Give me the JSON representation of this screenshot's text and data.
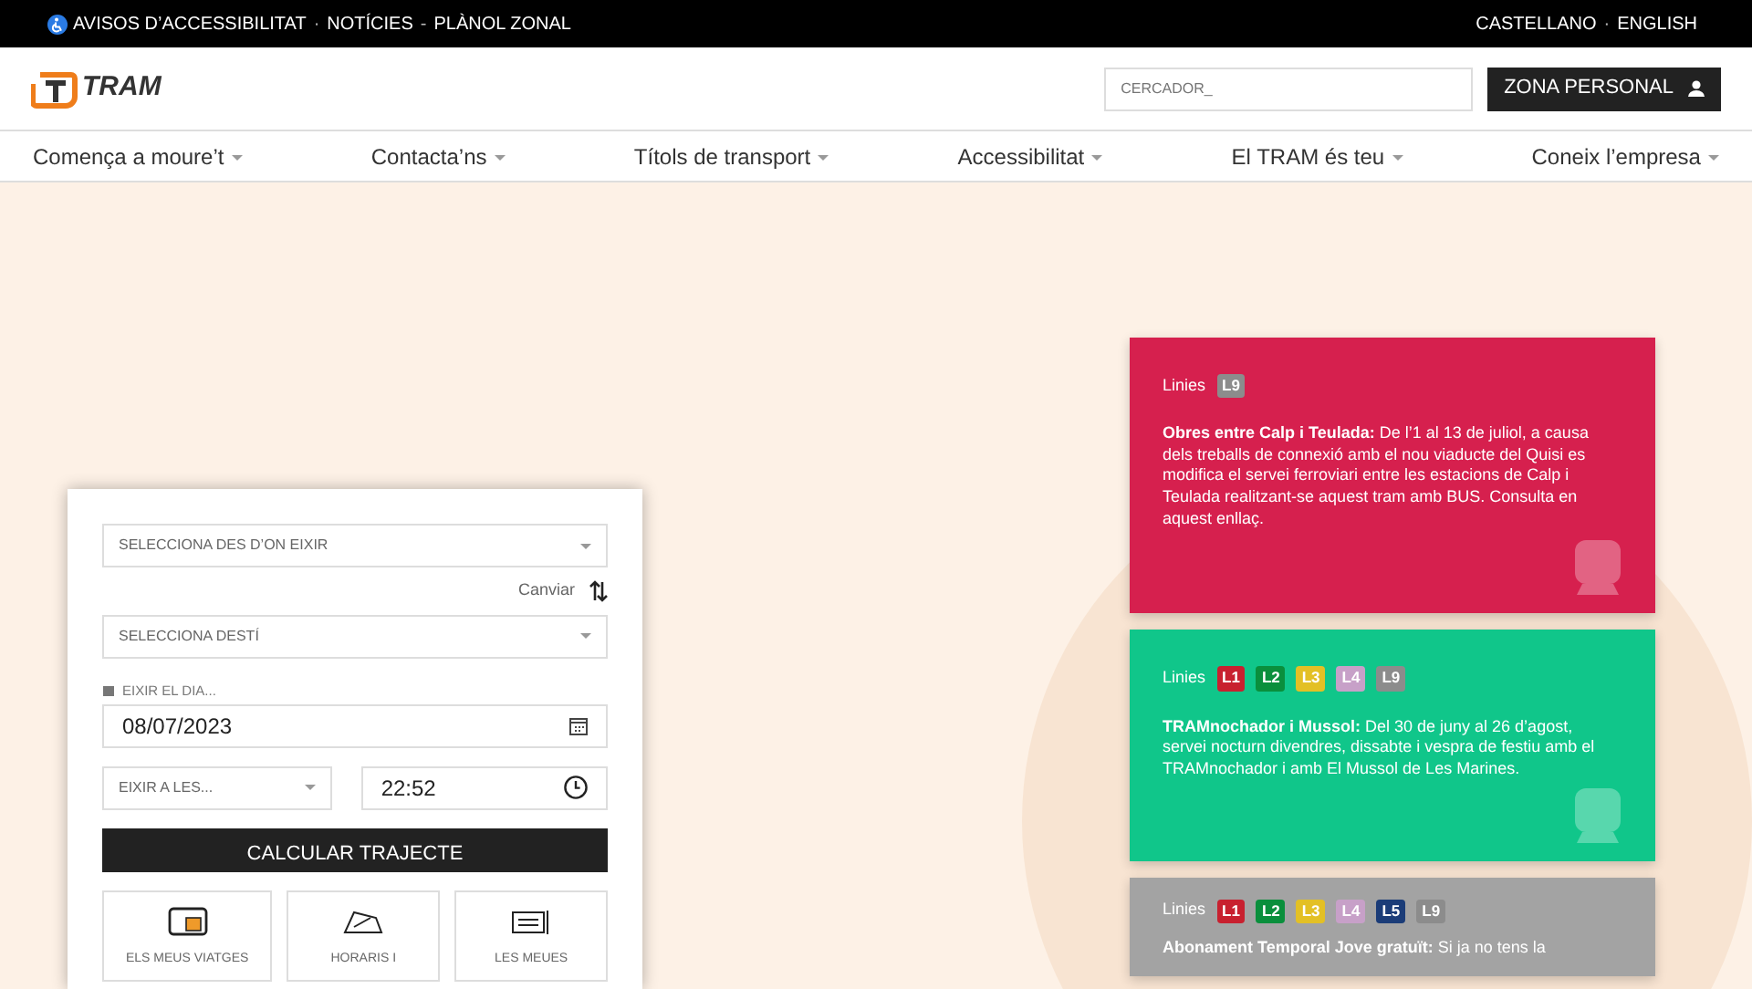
{
  "top_bar": {
    "left": [
      {
        "kind": "link",
        "text": "AVISOS D’ACCESSIBILITAT"
      },
      {
        "kind": "sep",
        "text": "·"
      },
      {
        "kind": "link",
        "text": "NOTÍCIES"
      },
      {
        "kind": "sep",
        "text": "-"
      },
      {
        "kind": "link",
        "text": "PLÀNOL ZONAL"
      }
    ],
    "right": [
      {
        "kind": "link",
        "text": "CASTELLANO"
      },
      {
        "kind": "sep",
        "text": "·"
      },
      {
        "kind": "link",
        "text": "ENGLISH"
      }
    ]
  },
  "header": {
    "logo": "TRAM",
    "search": {
      "placeholder": "CERCADOR_"
    },
    "account_button": "ZONA PERSONAL"
  },
  "nav": [
    "Comença a moure’t",
    "Contacta’ns",
    "Títols de transport",
    "Accessibilitat",
    "El TRAM és teu",
    "Coneix l’empresa"
  ],
  "planner": {
    "origin": {
      "placeholder": "SELECCIONA DES D’ON EIXIR"
    },
    "swap": "Canviar",
    "destination": {
      "placeholder": "SELECCIONA DESTÍ"
    },
    "date_label": "EIXIR EL DIA...",
    "date": "08/07/2023",
    "time_mode": "EIXIR A LES...",
    "time": "22:52",
    "submit": "CALCULAR TRAJECTE",
    "shortcuts": [
      {
        "kind": "card",
        "label": "ELS MEUS VIATGES"
      },
      {
        "kind": "map",
        "label": "HORARIS I"
      },
      {
        "kind": "ticket",
        "label": "LES MEUES"
      }
    ]
  },
  "notices": [
    {
      "color": "#d6204e",
      "lines_label": "Linies",
      "lines": [
        {
          "text": "L9",
          "color": "#8c8c8c"
        }
      ],
      "title": "Obres entre Calp i Teulada:",
      "body": "De l’1 al 13 de juliol, a causa dels treballs de connexió amb el nou viaducte del Quisi es modifica el servei ferroviari entre les estacions de Calp i Teulada realitzant-se aquest tram amb BUS. Consulta en aquest enllaç."
    },
    {
      "color": "#10c68a",
      "lines_label": "Linies",
      "lines": [
        {
          "text": "L1",
          "color": "#c8202f"
        },
        {
          "text": "L2",
          "color": "#0a8f3c"
        },
        {
          "text": "L3",
          "color": "#e3c025"
        },
        {
          "text": "L4",
          "color": "#c7a0c8"
        },
        {
          "text": "L9",
          "color": "#8c8c8c"
        }
      ],
      "title": "TRAMnochador i Mussol:",
      "body": "Del 30 de juny al 26 d’agost, servei nocturn divendres, dissabte i vespra de festiu amb el TRAMnochador  i amb El Mussol de Les Marines."
    },
    {
      "color": "#a3a3a3",
      "lines_label": "Linies",
      "lines": [
        {
          "text": "L1",
          "color": "#c8202f"
        },
        {
          "text": "L2",
          "color": "#0a8f3c"
        },
        {
          "text": "L3",
          "color": "#e3c025"
        },
        {
          "text": "L4",
          "color": "#c7a0c8"
        },
        {
          "text": "L5",
          "color": "#1b3c78"
        },
        {
          "text": "L9",
          "color": "#8c8c8c"
        }
      ],
      "title": "Abonament Temporal Jove gratuït:",
      "body": "Si ja no tens la"
    }
  ]
}
